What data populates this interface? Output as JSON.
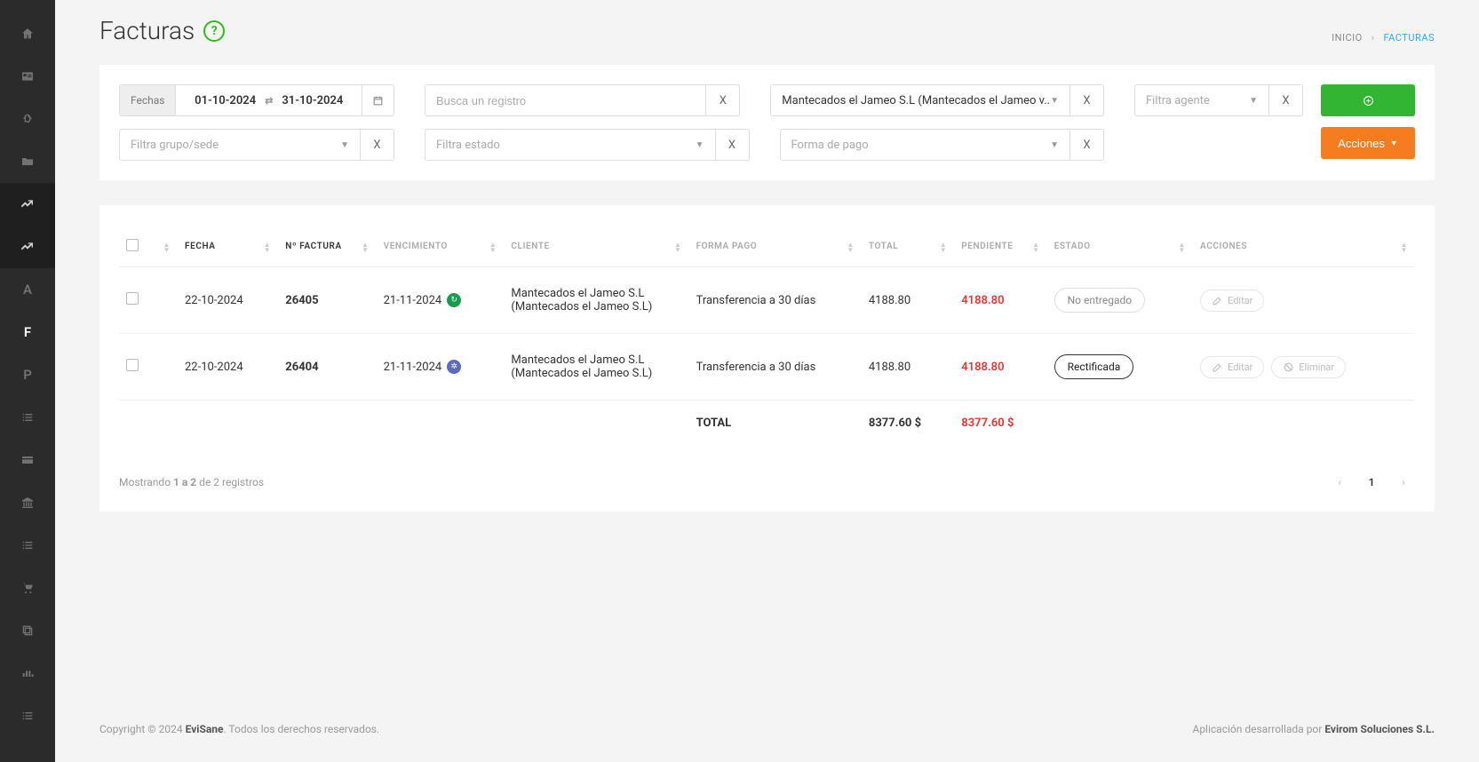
{
  "page": {
    "title": "Facturas"
  },
  "breadcrumb": {
    "home": "INICIO",
    "current": "FACTURAS"
  },
  "filters": {
    "date_label": "Fechas",
    "date_from": "01-10-2024",
    "date_to": "31-10-2024",
    "search_placeholder": "Busca un registro",
    "client_value": "Mantecados el Jameo S.L (Mantecados el Jameo v..",
    "agent_placeholder": "Filtra agente",
    "group_placeholder": "Filtra grupo/sede",
    "state_placeholder": "Filtra estado",
    "payment_placeholder": "Forma de pago",
    "clear": "X",
    "actions_label": "Acciones"
  },
  "table": {
    "headers": {
      "fecha": "FECHA",
      "nfactura": "Nº FACTURA",
      "vencimiento": "VENCIMIENTO",
      "cliente": "CLIENTE",
      "formapago": "FORMA PAGO",
      "total": "TOTAL",
      "pendiente": "PENDIENTE",
      "estado": "ESTADO",
      "acciones": "ACCIONES"
    },
    "rows": [
      {
        "fecha": "22-10-2024",
        "nfactura": "26405",
        "vencimiento": "21-11-2024",
        "venc_icon": "green",
        "cliente": "Mantecados el Jameo S.L (Mantecados el Jameo S.L)",
        "formapago": "Transferencia a 30 días",
        "total": "4188.80",
        "pendiente": "4188.80",
        "estado": "No entregado",
        "estado_style": "light",
        "actions": [
          "editar"
        ]
      },
      {
        "fecha": "22-10-2024",
        "nfactura": "26404",
        "vencimiento": "21-11-2024",
        "venc_icon": "blue",
        "cliente": "Mantecados el Jameo S.L (Mantecados el Jameo S.L)",
        "formapago": "Transferencia a 30 días",
        "total": "4188.80",
        "pendiente": "4188.80",
        "estado": "Rectificada",
        "estado_style": "dark",
        "actions": [
          "editar",
          "eliminar"
        ]
      }
    ],
    "totals": {
      "label": "TOTAL",
      "total": "8377.60 $",
      "pendiente": "8377.60 $"
    },
    "btn_editar": "Editar",
    "btn_eliminar": "Eliminar"
  },
  "pagination": {
    "showing_prefix": "Mostrando",
    "showing_range": "1 a 2",
    "showing_suffix": "de 2 registros",
    "current": "1"
  },
  "footer": {
    "copyright_prefix": "Copyright © 2024",
    "brand": "EviSane",
    "copyright_suffix": ". Todos los derechos reservados.",
    "dev_prefix": "Aplicación desarrollada por",
    "dev_name": "Evirom Soluciones S.L."
  }
}
